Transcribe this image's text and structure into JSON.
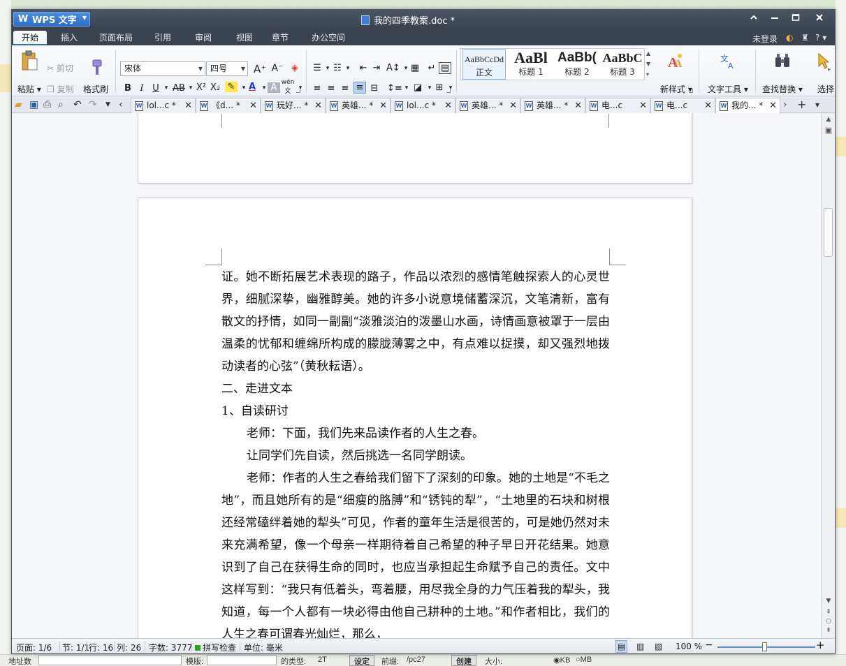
{
  "window": {
    "app_name": "WPS 文字",
    "doc_title": "我的四季教案.doc *"
  },
  "menu": {
    "tabs": [
      "开始",
      "插入",
      "页面布局",
      "引用",
      "审阅",
      "视图",
      "章节",
      "办公空间"
    ],
    "login": "未登录",
    "help": "?"
  },
  "ribbon": {
    "paste": "粘贴",
    "cut": "剪切",
    "copy": "复制",
    "format_painter": "格式刷",
    "font_name": "宋体",
    "font_size": "四号",
    "pinyin": "wén",
    "styles": [
      {
        "sample": "AaBbCcDd",
        "label": "正文"
      },
      {
        "sample": "AaBl",
        "label": "标题 1"
      },
      {
        "sample": "AaBb(",
        "label": "标题 2"
      },
      {
        "sample": "AaBbC",
        "label": "标题 3"
      }
    ],
    "new_style": "新样式",
    "text_tools": "文字工具",
    "find_replace": "查找替换",
    "select": "选择"
  },
  "doc_tabs": [
    {
      "label": "lol...c *",
      "active": false
    },
    {
      "label": "《d... *",
      "active": false
    },
    {
      "label": "玩好... *",
      "active": false
    },
    {
      "label": "英雄... *",
      "active": false
    },
    {
      "label": "lol...c *",
      "active": false
    },
    {
      "label": "英雄... *",
      "active": false
    },
    {
      "label": "英雄... *",
      "active": false
    },
    {
      "label": "电...c",
      "active": false
    },
    {
      "label": "电...c",
      "active": false
    },
    {
      "label": "我的... *",
      "active": true
    }
  ],
  "document": {
    "paragraphs": [
      {
        "text": "证。她不断拓展艺术表现的路子，作品以浓烈的感情笔触探索人的心灵世界，细腻深挚，幽雅醇美。她的许多小说意境储蓄深沉，文笔清新，富有散文的抒情，如同一副副“淡雅淡泊的泼墨山水画，诗情画意被罩于一层由温柔的忧郁和缠绵所构成的朦胧薄雾之中，有点难以捉摸，却又强烈地拨动读者的心弦”（黄秋耘语）。",
        "indent": false
      },
      {
        "text": "二、走进文本",
        "indent": false
      },
      {
        "text": "1、自读研讨",
        "indent": false
      },
      {
        "text": "老师：下面，我们先来品读作者的人生之春。",
        "indent": true
      },
      {
        "text": "让同学们先自读，然后挑选一名同学朗读。",
        "indent": true
      },
      {
        "text": "老师：作者的人生之春给我们留下了深刻的印象。她的土地是“不毛之地”，而且她所有的是“细瘦的胳膊”和“锈钝的犁”，“土地里的石块和树根还经常磕绊着她的犁头”可见，作者的童年生活是很苦的，可是她仍然对未来充满希望，像一个母亲一样期待着自己希望的种子早日开花结果。她意识到了自己在获得生命的同时，也应当承担起生命赋予自己的责任。文中这样写到：“我只有低着头，弯着腰，用尽我全身的力气压着我的犁头，我知道，每一个人都有一块必得由他自己耕种的土地。”和作者相比，我们的人生之春可谓春光灿烂，那么，",
        "indent": true
      }
    ]
  },
  "status": {
    "page": "页面: 1/6",
    "section": "节: 1/1",
    "line": "行: 16",
    "col": "列: 26",
    "words": "字数: 3777",
    "spell": "拼写检查",
    "unit": "单位: 毫米",
    "zoom": "100 %",
    "zoom_level_percent": 50
  },
  "background": {
    "field1": "地址数",
    "field2": "模版:",
    "field3": "的类型:",
    "field3_value": "2T",
    "btn1": "设定",
    "field4": "前缀:",
    "field4_value": "/pc27",
    "btn2": "创建",
    "field5": "大小:",
    "radio1": "KB",
    "radio2": "MB"
  },
  "colors": {
    "accent": "#2d6fc4",
    "titlebar": "#3b434f"
  }
}
